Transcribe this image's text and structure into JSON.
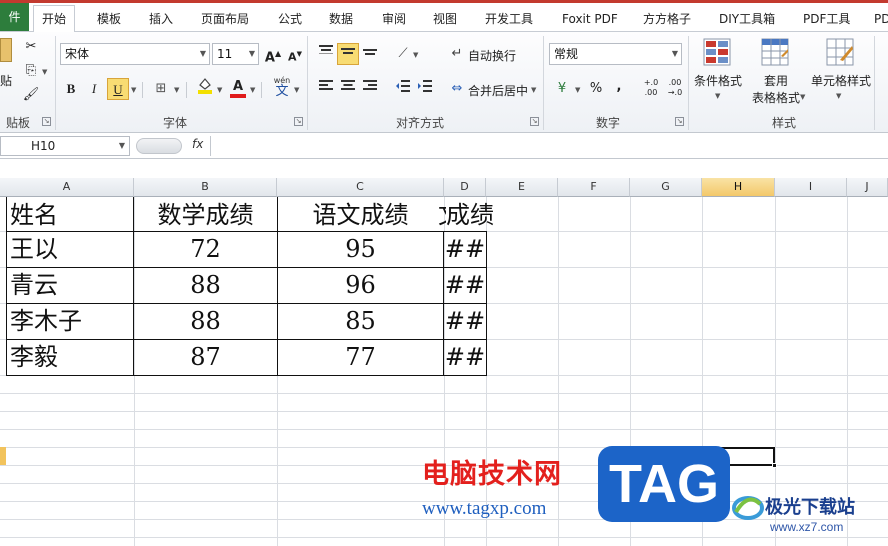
{
  "tabs": {
    "file": "件",
    "items": [
      "开始",
      "模板",
      "插入",
      "页面布局",
      "公式",
      "数据",
      "审阅",
      "视图",
      "开发工具",
      "Foxit PDF",
      "方方格子",
      "DIY工具箱",
      "PDF工具",
      "PD"
    ],
    "active": "开始"
  },
  "ribbon": {
    "clipboard": {
      "paste_label": "贴",
      "group_label": "贴板"
    },
    "font": {
      "font_name": "宋体",
      "font_size": "11",
      "grow_label": "A",
      "shrink_label": "A",
      "bold": "B",
      "italic": "I",
      "underline": "U",
      "font_color_letter": "A",
      "wen_label": "wén",
      "wen_char": "文",
      "group_label": "字体"
    },
    "alignment": {
      "wrap_label": "自动换行",
      "merge_label": "合并后居中",
      "group_label": "对齐方式"
    },
    "number": {
      "format": "常规",
      "percent": "%",
      "comma": ",",
      "inc_decimal": "+.0 .00",
      "dec_decimal": ".00 →.0",
      "group_label": "数字"
    },
    "styles": {
      "conditional": "条件格式",
      "table_format_1": "套用",
      "table_format_2": "表格格式",
      "cell_styles": "单元格样式",
      "group_label": "样式"
    }
  },
  "formula_bar": {
    "name_box": "H10",
    "fx": "fx",
    "value": ""
  },
  "columns": [
    "A",
    "B",
    "C",
    "D",
    "E",
    "F",
    "G",
    "H",
    "I",
    "J"
  ],
  "active_column": "H",
  "table": {
    "header": [
      "姓名",
      "数学成绩",
      "语文成绩",
      "成绩"
    ],
    "rows": [
      [
        "王以",
        "72",
        "95",
        "##"
      ],
      [
        "青云",
        "88",
        "96",
        "##"
      ],
      [
        "李木子",
        "88",
        "85",
        "##"
      ],
      [
        "李毅",
        "87",
        "77",
        "##"
      ]
    ]
  },
  "watermark": {
    "cn": "电脑技术网",
    "url": "www.tagxp.com",
    "tag": "TAG",
    "logo_cn": "极光下载站",
    "logo_url": "www.xz7.com"
  },
  "colors": {
    "accent_tab": "#c33a2f",
    "file_tab": "#2d7d3c",
    "selected_button": "#f8dc73",
    "active_header": "#f3c86a",
    "watermark_red": "#e3201d",
    "watermark_blue": "#1c64c8"
  }
}
